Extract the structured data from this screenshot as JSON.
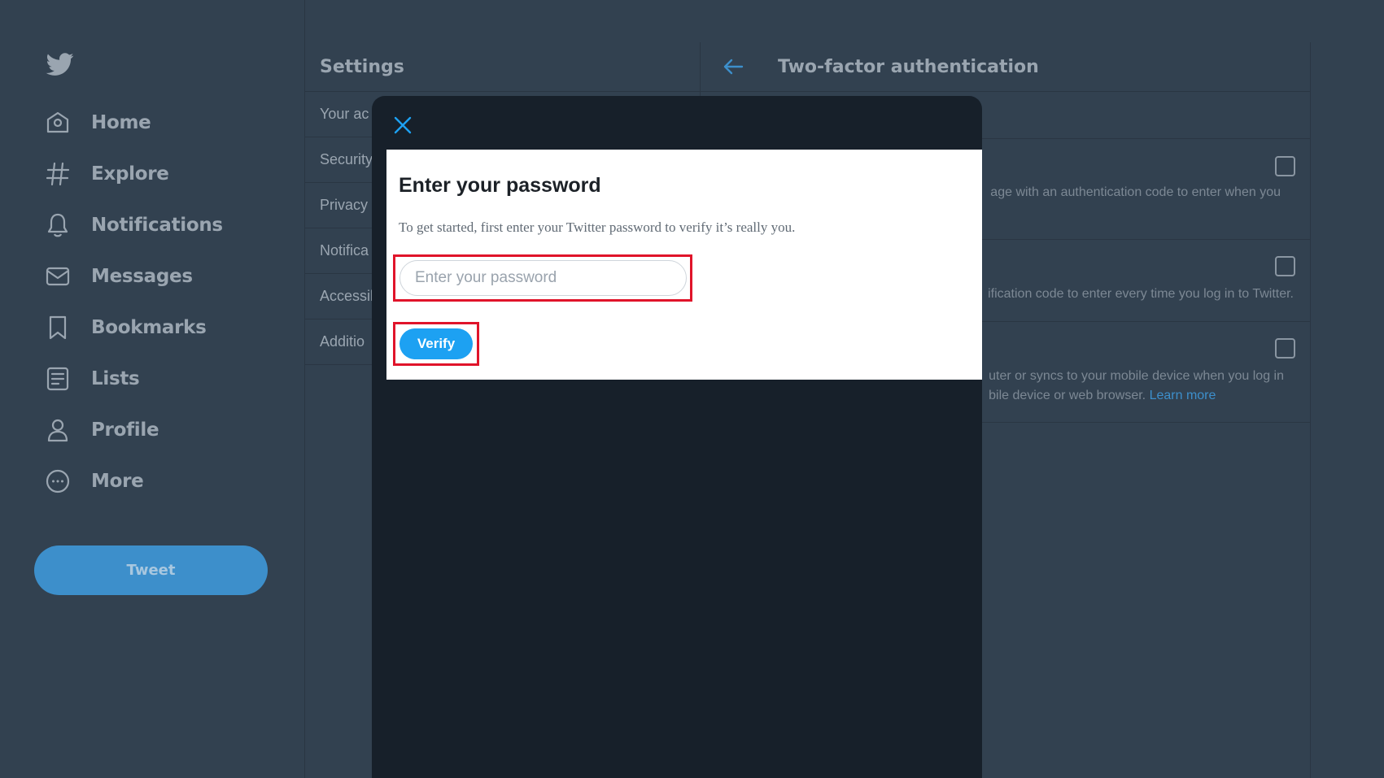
{
  "nav": {
    "items": [
      {
        "label": "Home",
        "icon": "home-icon"
      },
      {
        "label": "Explore",
        "icon": "hashtag-icon"
      },
      {
        "label": "Notifications",
        "icon": "bell-icon"
      },
      {
        "label": "Messages",
        "icon": "envelope-icon"
      },
      {
        "label": "Bookmarks",
        "icon": "bookmark-icon"
      },
      {
        "label": "Lists",
        "icon": "list-icon"
      },
      {
        "label": "Profile",
        "icon": "person-icon"
      },
      {
        "label": "More",
        "icon": "more-circle-icon"
      }
    ],
    "tweet_label": "Tweet"
  },
  "settings": {
    "title": "Settings",
    "items": [
      "Your ac",
      "Security",
      "Privacy",
      "Notifica",
      "Accessil",
      "Additio"
    ]
  },
  "detail": {
    "title": "Two-factor authentication",
    "rows": [
      {
        "lines": [
          "age with an authentication code to enter when you"
        ]
      },
      {
        "lines": [
          "ification code to enter every time you log in to Twitter."
        ]
      },
      {
        "lines": [
          "uter or syncs to your mobile device when you log in",
          "bile device or web browser."
        ],
        "link": "Learn more"
      }
    ]
  },
  "modal": {
    "heading": "Enter your password",
    "description": "To get started, first enter your Twitter password to verify it’s really you.",
    "password_placeholder": "Enter your password",
    "password_value": "",
    "verify_label": "Verify"
  },
  "colors": {
    "background": "#324150",
    "modal": "#17202a",
    "accent": "#1da1f2",
    "highlight": "#e0142a"
  }
}
